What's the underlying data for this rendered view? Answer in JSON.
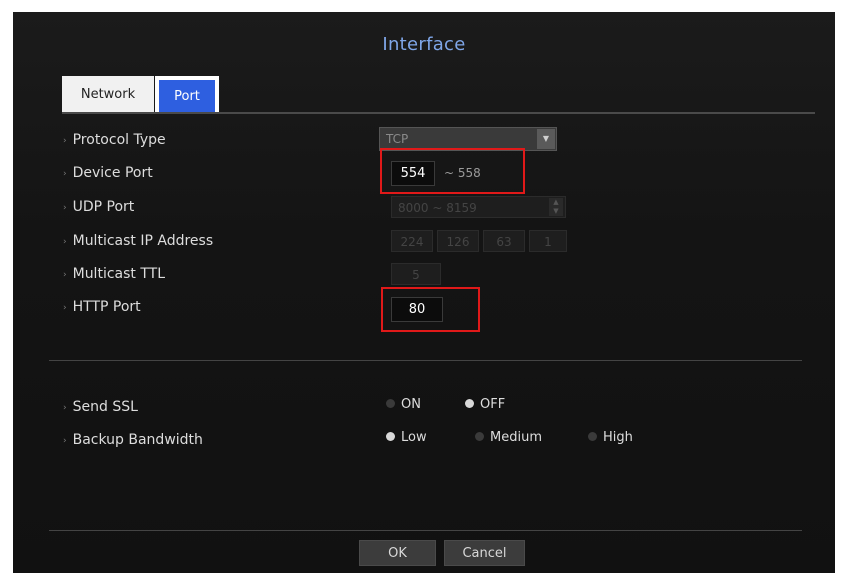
{
  "dialog": {
    "title": "Interface"
  },
  "tabs": [
    {
      "label": "Network"
    },
    {
      "label": "Port"
    }
  ],
  "protocol_type": {
    "label": "Protocol Type",
    "value": "TCP"
  },
  "device_port": {
    "label": "Device Port",
    "value": "554",
    "range_suffix": "~ 558"
  },
  "udp_port": {
    "label": "UDP Port",
    "value": "8000 ~ 8159"
  },
  "multicast_ip": {
    "label": "Multicast IP Address",
    "octets": [
      "224",
      "126",
      "63",
      "1"
    ]
  },
  "multicast_ttl": {
    "label": "Multicast TTL",
    "value": "5"
  },
  "http_port": {
    "label": "HTTP Port",
    "value": "80"
  },
  "send_ssl": {
    "label": "Send SSL",
    "options": [
      "ON",
      "OFF"
    ],
    "selected": "OFF"
  },
  "backup_bandwidth": {
    "label": "Backup Bandwidth",
    "options": [
      "Low",
      "Medium",
      "High"
    ],
    "selected": "Low"
  },
  "buttons": {
    "ok": "OK",
    "cancel": "Cancel"
  },
  "colors": {
    "title": "#7fa6e8",
    "tab_active": "#2e5fe0",
    "highlight": "#e01919"
  }
}
